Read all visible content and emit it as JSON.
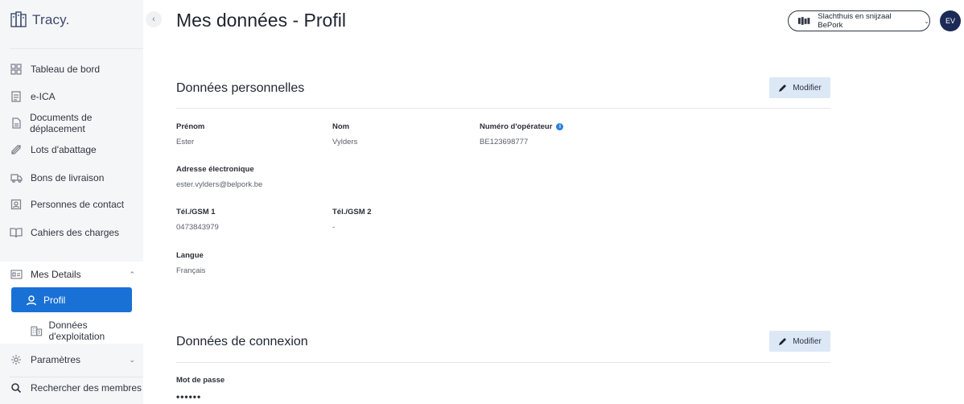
{
  "app": {
    "logo_text": "Tracy.",
    "collapse_glyph": "‹"
  },
  "sidebar": {
    "items": [
      {
        "label": "Tableau de bord",
        "icon": "dashboard-icon"
      },
      {
        "label": "e-ICA",
        "icon": "document-icon"
      },
      {
        "label": "Documents de déplacement",
        "icon": "file-icon"
      },
      {
        "label": "Lots d'abattage",
        "icon": "tag-icon"
      },
      {
        "label": "Bons de livraison",
        "icon": "truck-icon"
      },
      {
        "label": "Personnes de contact",
        "icon": "contact-icon"
      },
      {
        "label": "Cahiers des charges",
        "icon": "book-icon"
      }
    ],
    "group": {
      "label": "Mes Details",
      "icon": "id-card-icon",
      "sub_items": [
        {
          "label": "Profil",
          "icon": "user-icon",
          "active": true
        },
        {
          "label": "Données d'exploitation",
          "icon": "building-icon",
          "active": false
        }
      ]
    },
    "settings": {
      "label": "Paramètres",
      "icon": "gear-icon"
    },
    "search_members": {
      "label": "Rechercher des membres",
      "icon": "search-icon"
    }
  },
  "header": {
    "title": "Mes données - Profil",
    "organization": "Slachthuis en snijzaal BePork",
    "avatar_initials": "EV"
  },
  "personal": {
    "title": "Données personnelles",
    "edit_label": "Modifier",
    "first_name_label": "Prénom",
    "first_name": "Ester",
    "last_name_label": "Nom",
    "last_name": "Vylders",
    "operator_label": "Numéro d'opérateur",
    "operator_number": "BE123698777",
    "email_label": "Adresse électronique",
    "email": "ester.vylders@belpork.be",
    "phone1_label": "Tél./GSM 1",
    "phone1": "0473843979",
    "phone2_label": "Tél./GSM 2",
    "phone2": "-",
    "language_label": "Langue",
    "language": "Français"
  },
  "connection": {
    "title": "Données de connexion",
    "edit_label": "Modifier",
    "password_label": "Mot de passe",
    "password": "••••••"
  },
  "colors": {
    "accent": "#1971d6",
    "edit_button_bg": "#dde8f6",
    "avatar_bg": "#1b2a57"
  }
}
